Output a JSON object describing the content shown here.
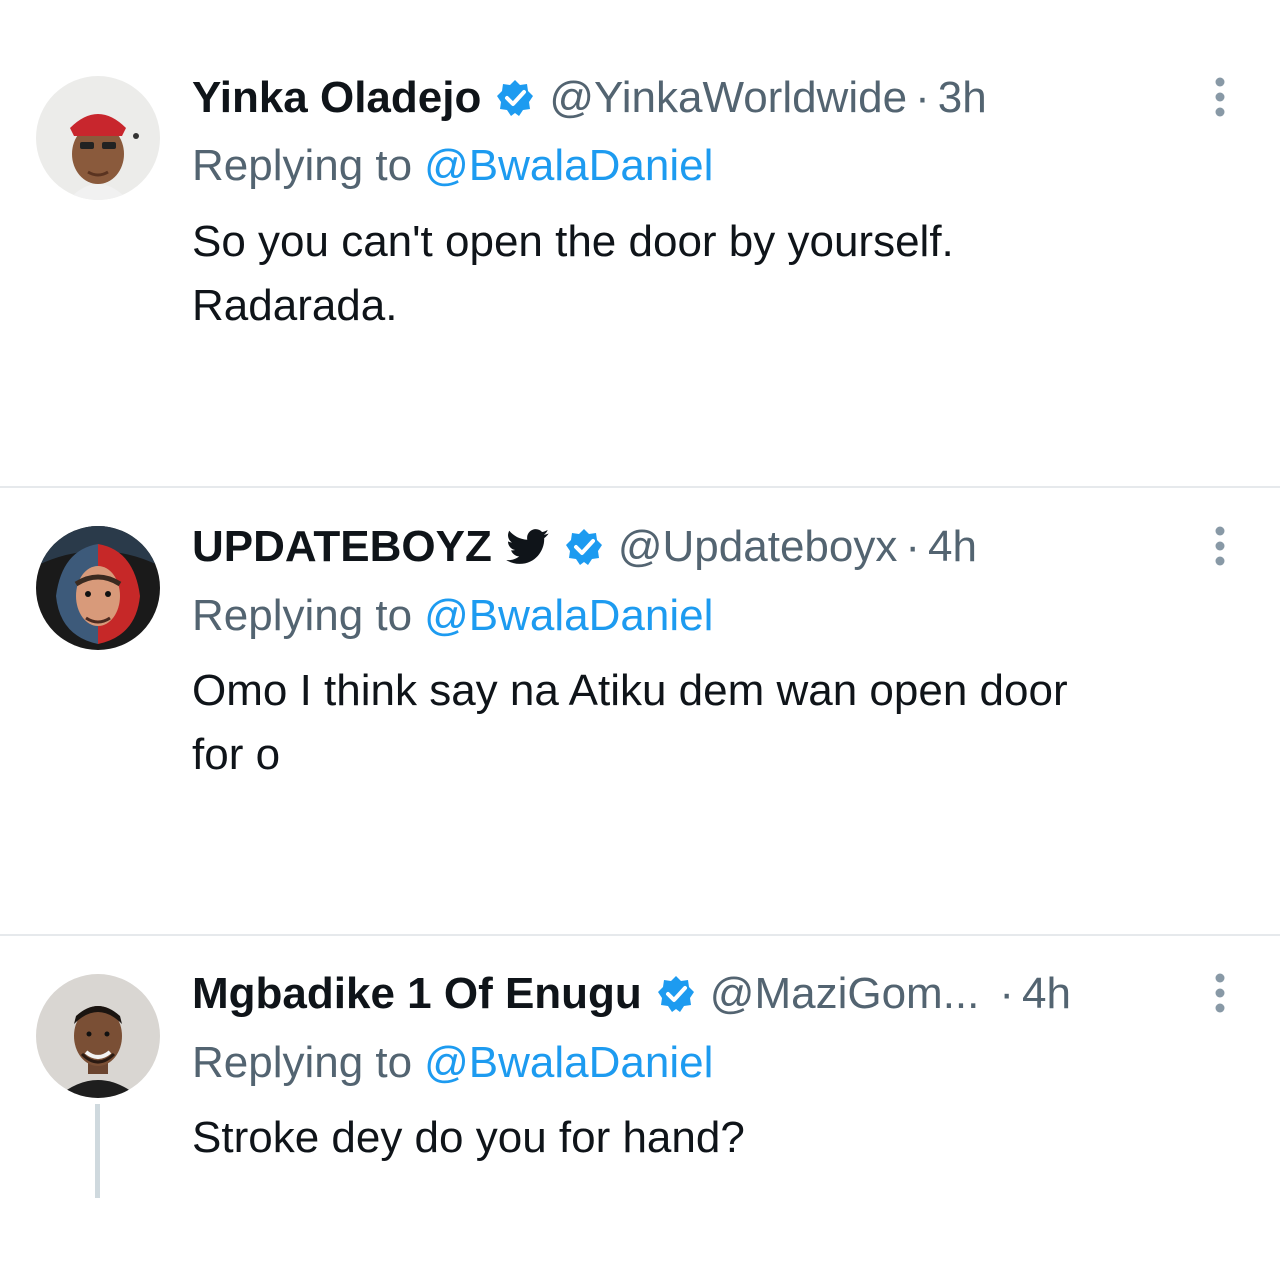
{
  "replies": [
    {
      "display_name": "Yinka Oladejo",
      "handle": "@YinkaWorldwide",
      "dot": "·",
      "time": "3h",
      "replying_label": "Replying to",
      "replying_to": "@BwalaDaniel",
      "text": "So you can't open the door by yourself.\nRadarada.",
      "verified": true,
      "avatar_icon": "portrait-red-cap"
    },
    {
      "display_name": "UPDATEBOYZ",
      "handle": "@Updateboyx",
      "dot": "·",
      "time": "4h",
      "replying_label": "Replying to",
      "replying_to": "@BwalaDaniel",
      "text": "Omo I think say na Atiku dem wan open door\nfor o",
      "verified": true,
      "name_icon": "bird-icon",
      "avatar_icon": "red-blue-face-art"
    },
    {
      "display_name": "Mgbadike 1 Of Enugu",
      "handle": "@MaziGom...",
      "dot": "·",
      "time": "4h",
      "replying_label": "Replying to",
      "replying_to": "@BwalaDaniel",
      "text": "Stroke dey do you for hand?",
      "verified": true,
      "avatar_icon": "portrait-smiling-man"
    }
  ],
  "colors": {
    "verified": "#1d9bf0",
    "link": "#1d9bf0",
    "secondary_text": "#536471",
    "primary_text": "#0f1419",
    "divider": "#e6e9ec"
  }
}
